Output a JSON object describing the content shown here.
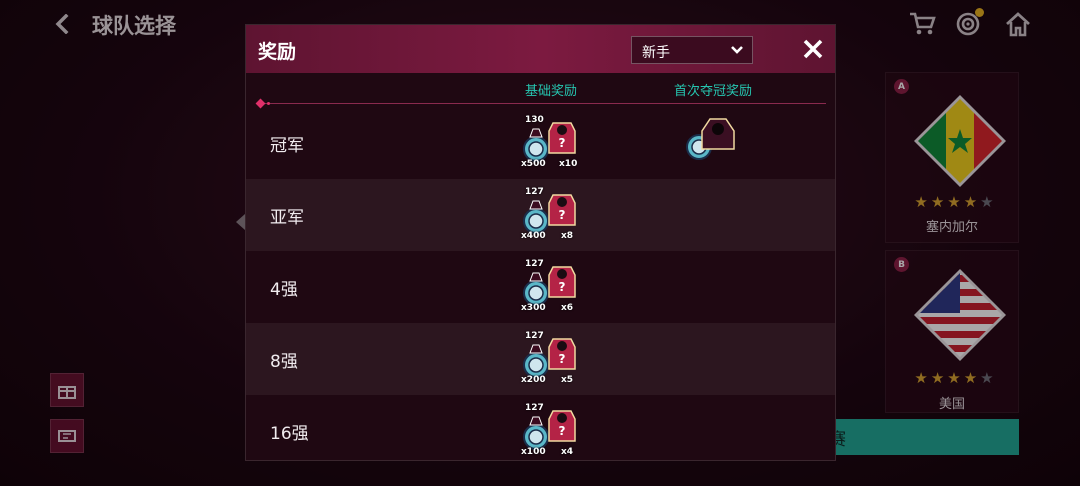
{
  "header": {
    "title": "球队选择",
    "icons": [
      "back-chevron-icon",
      "cart-icon",
      "target-icon",
      "home-icon"
    ]
  },
  "background": {
    "teams": [
      {
        "group": "A",
        "name": "塞内加尔",
        "stars": 4
      },
      {
        "group": "B",
        "name": "美国",
        "stars": 4
      }
    ],
    "join_button": "加入比赛"
  },
  "modal": {
    "title": "奖励",
    "difficulty": {
      "selected": "新手"
    },
    "columns": {
      "base": "基础奖励",
      "first": "首次夺冠奖励"
    },
    "rows": [
      {
        "label": "冠军",
        "level": "130",
        "coins": "x500",
        "packs": "x10",
        "first_reward": true
      },
      {
        "label": "亚军",
        "level": "127",
        "coins": "x400",
        "packs": "x8",
        "first_reward": false
      },
      {
        "label": "4强",
        "level": "127",
        "coins": "x300",
        "packs": "x6",
        "first_reward": false
      },
      {
        "label": "8强",
        "level": "127",
        "coins": "x200",
        "packs": "x5",
        "first_reward": false
      },
      {
        "label": "16强",
        "level": "127",
        "coins": "x100",
        "packs": "x4",
        "first_reward": false
      }
    ]
  },
  "colors": {
    "accent_teal": "#26c6b0",
    "header_magenta": "#7c1a40",
    "star_gold": "#d9a531"
  }
}
